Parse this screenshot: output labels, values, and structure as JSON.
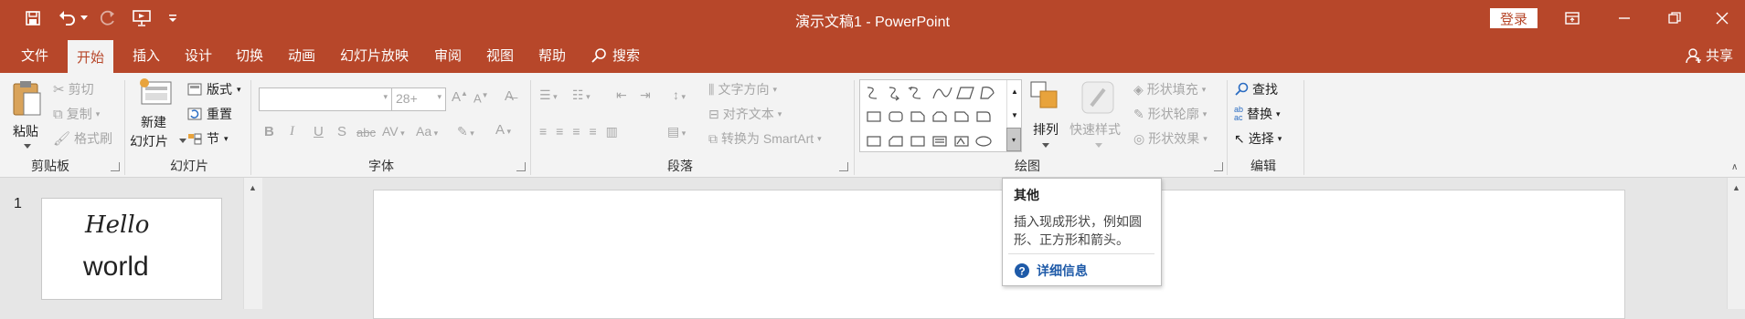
{
  "colors": {
    "accent": "#b7472a",
    "ribbon_bg": "#f3f3f3",
    "link": "#1e5aa8"
  },
  "title": {
    "text": "演示文稿1  -  PowerPoint",
    "login": "登录"
  },
  "tabs": [
    "文件",
    "开始",
    "插入",
    "设计",
    "切换",
    "动画",
    "幻灯片放映",
    "审阅",
    "视图",
    "帮助"
  ],
  "tell_me": "搜索",
  "share": "共享",
  "clipboard": {
    "paste": "粘贴",
    "cut": "剪切",
    "copy": "复制",
    "format_painter": "格式刷",
    "label": "剪贴板"
  },
  "slides": {
    "new_slide_line1": "新建",
    "new_slide_line2": "幻灯片",
    "layout": "版式",
    "reset": "重置",
    "section": "节",
    "label": "幻灯片"
  },
  "font": {
    "name": "",
    "size": "28+",
    "label": "字体",
    "bold": "B",
    "italic": "I",
    "underline": "U",
    "shadow": "S",
    "strike": "abc",
    "spacing": "AV",
    "case": "Aa",
    "increase": "A",
    "decrease": "A",
    "color": "A"
  },
  "paragraph": {
    "text_direction": "文字方向",
    "align_text": "对齐文本",
    "smartart": "转换为 SmartArt",
    "label": "段落"
  },
  "drawing": {
    "arrange": "排列",
    "quick_styles": "快速样式",
    "fill": "形状填充",
    "outline": "形状轮廓",
    "effects": "形状效果",
    "label": "绘图"
  },
  "editing": {
    "find": "查找",
    "replace": "替换",
    "select": "选择",
    "label": "编辑"
  },
  "slide_panel": {
    "number": "1",
    "line1": "Hello",
    "line2": "world"
  },
  "tooltip": {
    "title": "其他",
    "body_line1": "插入现成形状，例如圆",
    "body_line2": "形、正方形和箭头。",
    "link": "详细信息"
  }
}
